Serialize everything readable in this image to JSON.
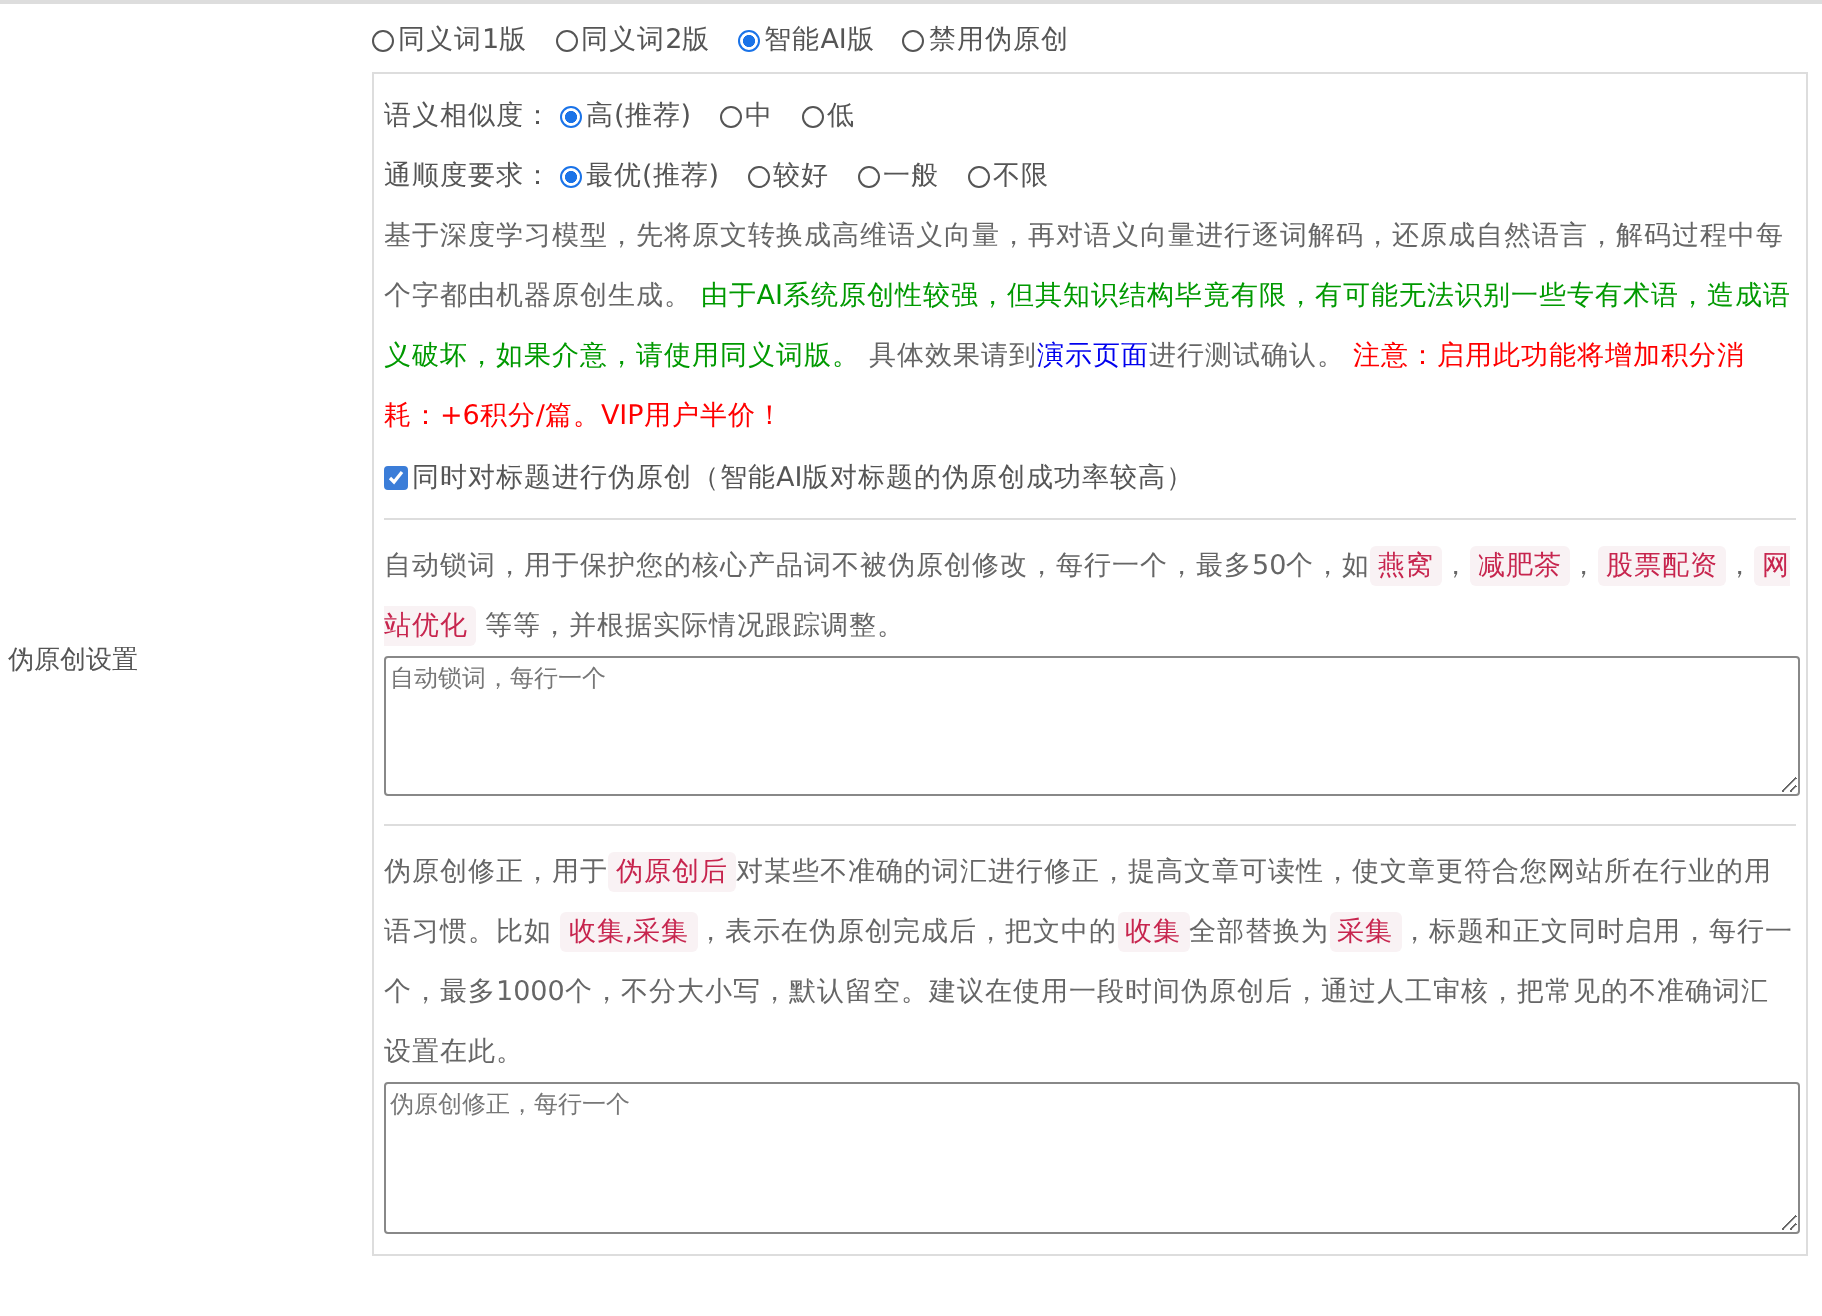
{
  "section_label": "伪原创设置",
  "modes": [
    {
      "label": "同义词1版",
      "selected": false
    },
    {
      "label": "同义词2版",
      "selected": false
    },
    {
      "label": "智能AI版",
      "selected": true
    },
    {
      "label": "禁用伪原创",
      "selected": false
    }
  ],
  "option_groups": [
    {
      "label": "语义相似度：",
      "options": [
        {
          "label": "高(推荐)",
          "selected": true
        },
        {
          "label": "中",
          "selected": false
        },
        {
          "label": "低",
          "selected": false
        }
      ]
    },
    {
      "label": "通顺度要求：",
      "options": [
        {
          "label": "最优(推荐)",
          "selected": true
        },
        {
          "label": "较好",
          "selected": false
        },
        {
          "label": "一般",
          "selected": false
        },
        {
          "label": "不限",
          "selected": false
        }
      ]
    }
  ],
  "ai_description": [
    {
      "kind": "text",
      "text": "基于深度学习模型，先将原文转换成高维语义向量，再对语义向量进行逐词解码，还原成自然语言，解码过程中每个字都由机器原创生成。 "
    },
    {
      "kind": "note",
      "text": "由于AI系统原创性较强，但其知识结构毕竟有限，有可能无法识别一些专有术语，造成语义破坏，如果介意，请使用同义词版。"
    },
    {
      "kind": "text",
      "text": " 具体效果请到"
    },
    {
      "kind": "link",
      "text": "演示页面"
    },
    {
      "kind": "text",
      "text": "进行测试确认。 "
    },
    {
      "kind": "warning",
      "text": "注意：启用此功能将增加积分消耗：+6积分/篇。VIP用户半价！"
    }
  ],
  "title_option": {
    "label": "同时对标题进行伪原创（智能AI版对标题的伪原创成功率较高）",
    "checked": true
  },
  "lock_words": {
    "description": [
      {
        "kind": "text",
        "text": "自动锁词，用于保护您的核心产品词不被伪原创修改，每行一个，最多50个，如"
      },
      {
        "kind": "tag",
        "text": "燕窝"
      },
      {
        "kind": "text",
        "text": "，"
      },
      {
        "kind": "tag",
        "text": "减肥茶"
      },
      {
        "kind": "text",
        "text": "，"
      },
      {
        "kind": "tag",
        "text": "股票配资"
      },
      {
        "kind": "text",
        "text": "，"
      },
      {
        "kind": "tag",
        "text": "网站优化"
      },
      {
        "kind": "text",
        "text": " 等等，并根据实际情况跟踪调整。"
      }
    ],
    "placeholder": "自动锁词，每行一个"
  },
  "corrections": {
    "description": [
      {
        "kind": "text",
        "text": "伪原创修正，用于"
      },
      {
        "kind": "tag",
        "text": "伪原创后"
      },
      {
        "kind": "text",
        "text": "对某些不准确的词汇进行修正，提高文章可读性，使文章更符合您网站所在行业的用语习惯。比如 "
      },
      {
        "kind": "tag",
        "text": "收集,采集"
      },
      {
        "kind": "text",
        "text": "，表示在伪原创完成后，把文中的"
      },
      {
        "kind": "tag",
        "text": "收集"
      },
      {
        "kind": "text",
        "text": "全部替换为"
      },
      {
        "kind": "tag",
        "text": "采集"
      },
      {
        "kind": "text",
        "text": "，标题和正文同时启用，每行一个，最多1000个，不分大小写，默认留空。建议在使用一段时间伪原创后，通过人工审核，把常见的不准确词汇设置在此。"
      }
    ],
    "placeholder": "伪原创修正，每行一个"
  }
}
